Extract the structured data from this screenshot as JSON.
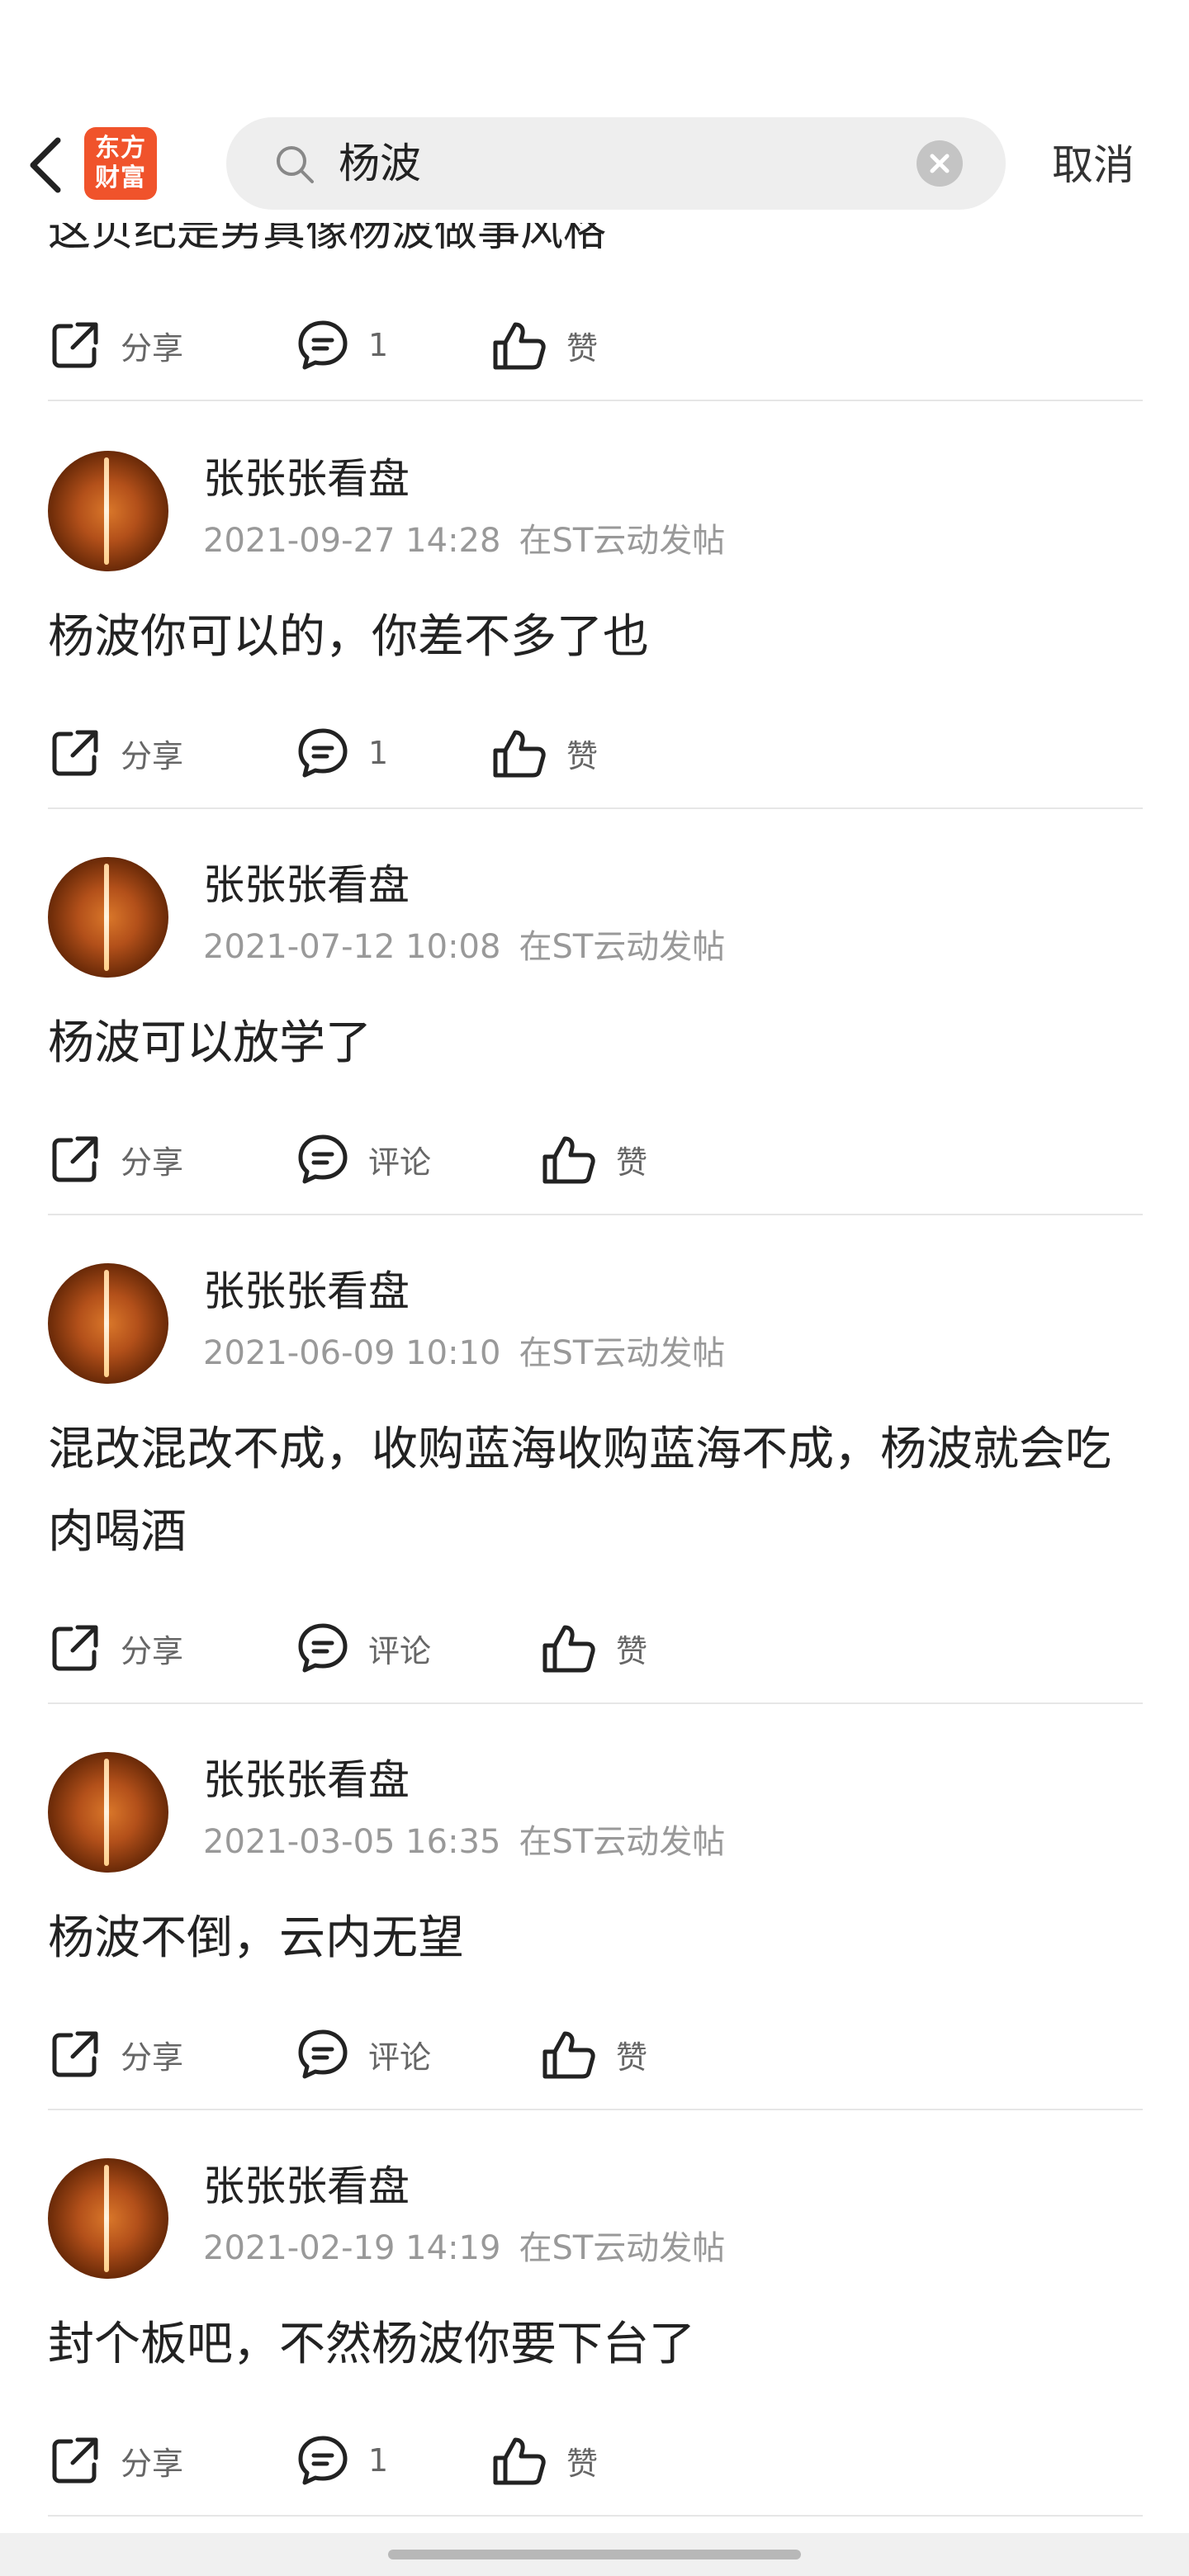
{
  "header": {
    "logo_line1": "东方",
    "logo_line2": "财富",
    "search_query": "杨波",
    "cancel_label": "取消"
  },
  "top_partial_post": {
    "cut_text": "这贝纪是男真像杨波做事风格",
    "share_label": "分享",
    "comment_label": "1",
    "like_label": "赞"
  },
  "posts": [
    {
      "author": "张张张看盘",
      "time": "2021-09-27 14:28",
      "board": "在ST云动发帖",
      "content": "杨波你可以的，你差不多了也",
      "share_label": "分享",
      "comment_label": "1",
      "like_label": "赞"
    },
    {
      "author": "张张张看盘",
      "time": "2021-07-12 10:08",
      "board": "在ST云动发帖",
      "content": "杨波可以放学了",
      "share_label": "分享",
      "comment_label": "评论",
      "like_label": "赞"
    },
    {
      "author": "张张张看盘",
      "time": "2021-06-09 10:10",
      "board": "在ST云动发帖",
      "content": "混改混改不成，收购蓝海收购蓝海不成，杨波就会吃肉喝酒",
      "share_label": "分享",
      "comment_label": "评论",
      "like_label": "赞"
    },
    {
      "author": "张张张看盘",
      "time": "2021-03-05 16:35",
      "board": "在ST云动发帖",
      "content": "杨波不倒，云内无望",
      "share_label": "分享",
      "comment_label": "评论",
      "like_label": "赞"
    },
    {
      "author": "张张张看盘",
      "time": "2021-02-19 14:19",
      "board": "在ST云动发帖",
      "content": "封个板吧，不然杨波你要下台了",
      "share_label": "分享",
      "comment_label": "1",
      "like_label": "赞"
    }
  ],
  "colors": {
    "logo_bg": "#f0532b",
    "text_primary": "#222222",
    "text_meta": "#999999",
    "divider": "#e6e6e6"
  },
  "icons": {
    "back": "chevron-left-icon",
    "search": "search-icon",
    "clear": "clear-circle-icon",
    "share": "share-icon",
    "comment": "comment-bubble-icon",
    "like": "thumbs-up-icon"
  }
}
